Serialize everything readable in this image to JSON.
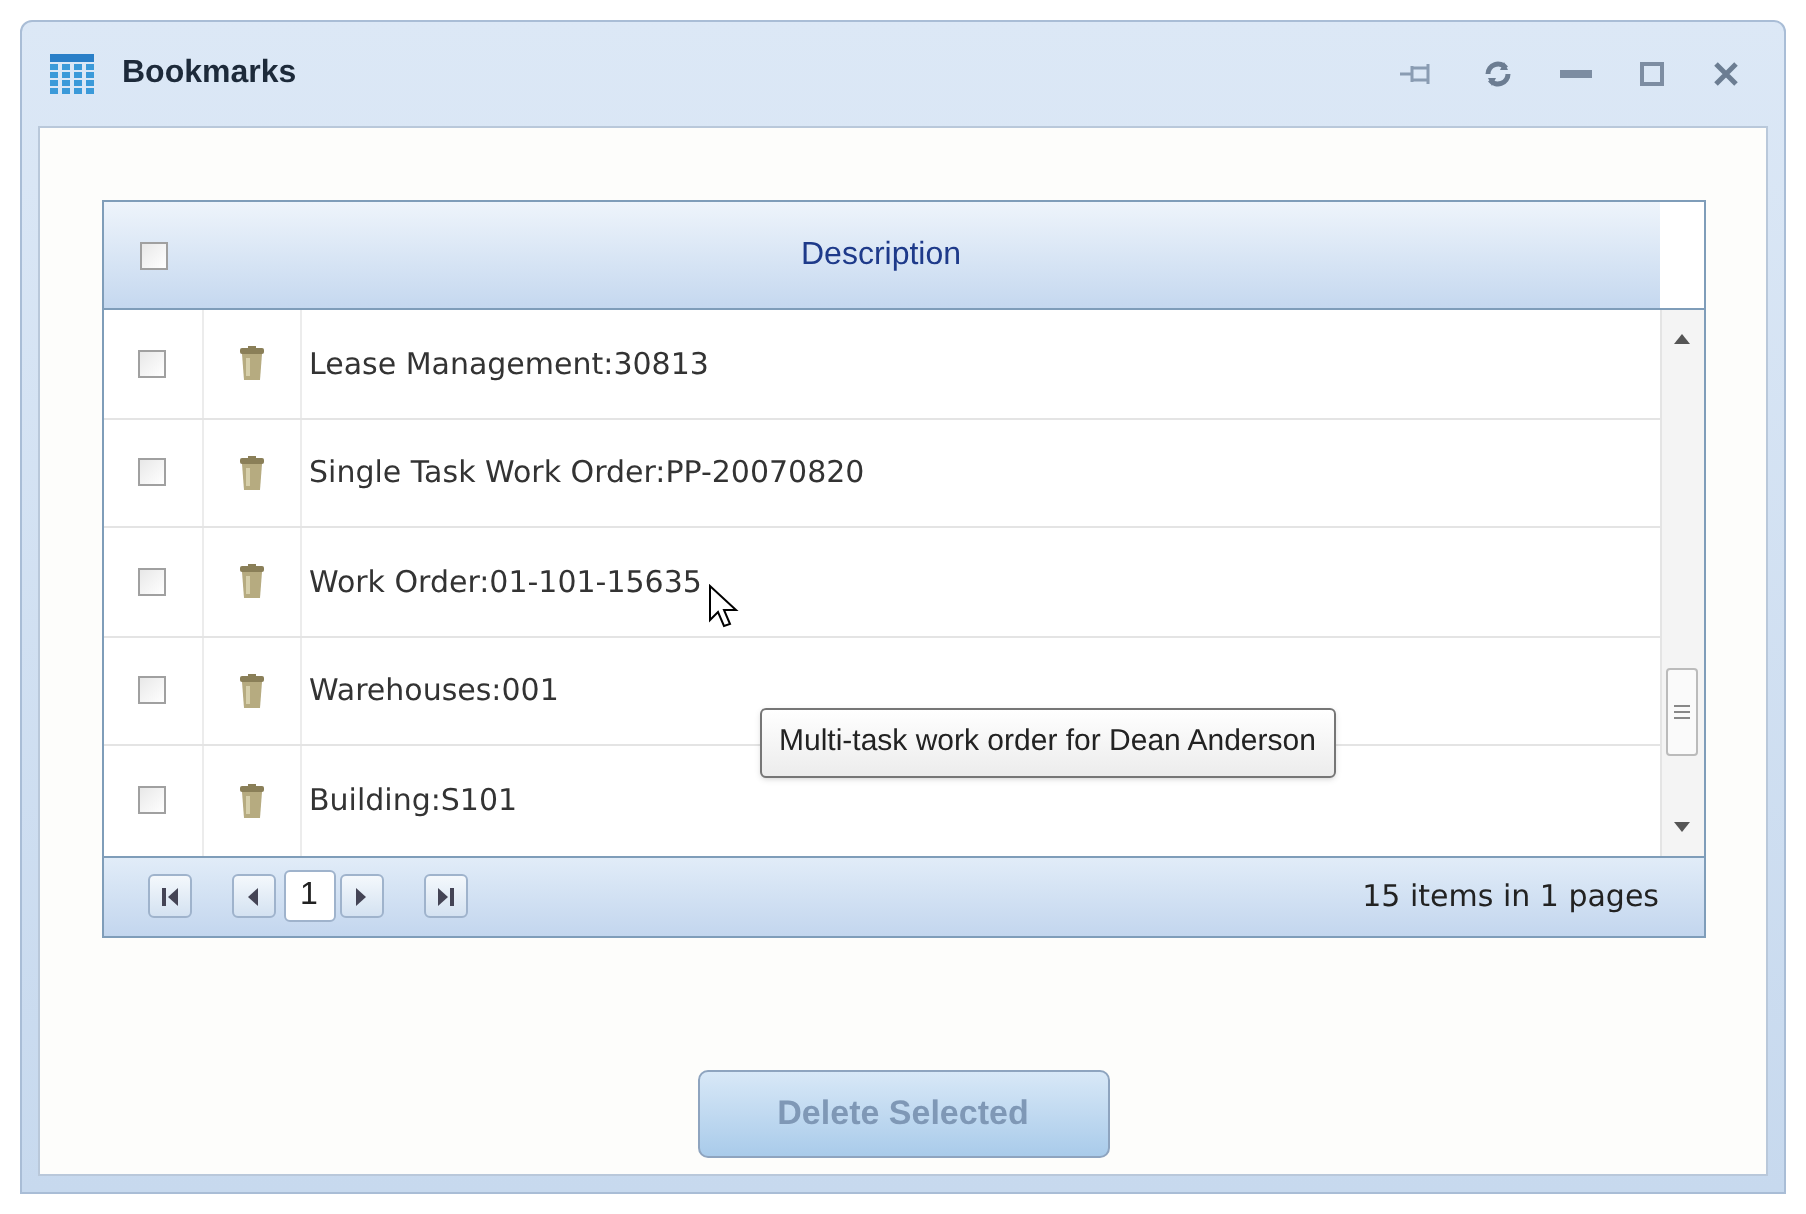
{
  "window": {
    "title": "Bookmarks"
  },
  "table": {
    "header_checkbox": {
      "checked": false
    },
    "columns": [
      {
        "label": "Description"
      }
    ],
    "rows": [
      {
        "checked": false,
        "description": "Lease Management:30813"
      },
      {
        "checked": false,
        "description": "Single Task Work Order:PP-20070820"
      },
      {
        "checked": false,
        "description": "Work Order:01-101-15635"
      },
      {
        "checked": false,
        "description": "Warehouses:001"
      },
      {
        "checked": false,
        "description": "Building:S101"
      }
    ]
  },
  "tooltip": {
    "text": "Multi-task work order for Dean Anderson"
  },
  "pager": {
    "current_page": "1",
    "summary": "15 items in 1 pages"
  },
  "delete_button": {
    "label": "Delete Selected",
    "disabled": true
  }
}
